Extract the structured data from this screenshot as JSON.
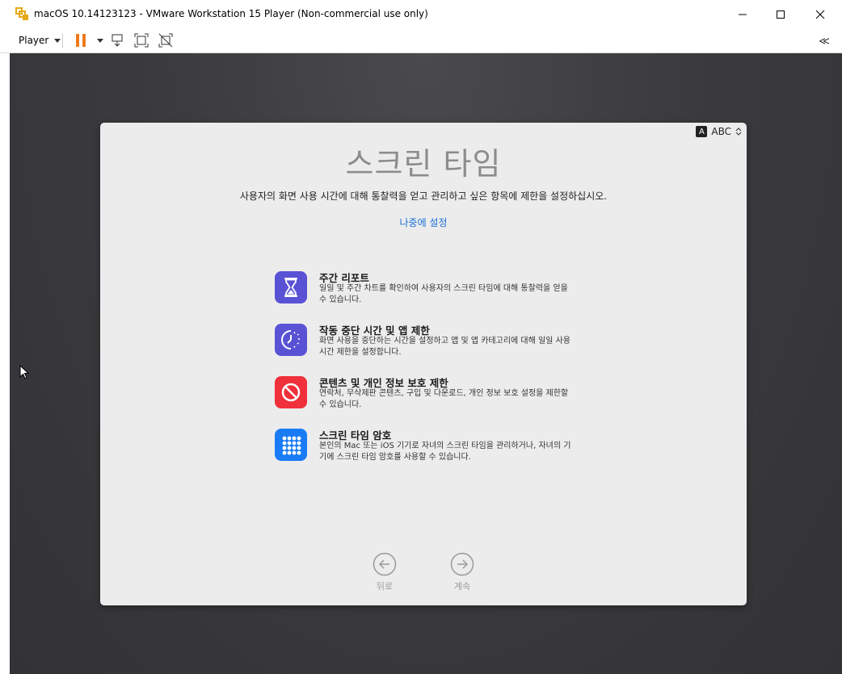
{
  "window": {
    "title": "macOS 10.14123123 - VMware Workstation 15 Player (Non-commercial use only)",
    "controls": [
      "minimize",
      "maximize",
      "close"
    ]
  },
  "toolbar": {
    "player_menu": "Player",
    "collapse_label": "≪"
  },
  "setup": {
    "input_source": "ABC",
    "input_badge": "A",
    "title": "스크린 타임",
    "description": "사용자의 화면 사용 시간에 대해 통찰력을 얻고 관리하고 싶은 항목에 제한을 설정하십시오.",
    "later_link": "나중에 설정",
    "features": [
      {
        "title": "주간 리포트",
        "desc": "일일 및 주간 차트를 확인하여 사용자의 스크린 타임에 대해 통찰력을 얻을 수 있습니다.",
        "icon": "hourglass-icon",
        "color": "#5a52d5"
      },
      {
        "title": "작동 중단 시간 및 앱 제한",
        "desc": "화면 사용을 중단하는 시간을 설정하고 앱 및 앱 카테고리에 대해 일일 사용 시간 제한을 설정합니다.",
        "icon": "downtime-icon",
        "color": "#5a52d5"
      },
      {
        "title": "콘텐츠 및 개인 정보 보호 제한",
        "desc": "연락처, 무삭제판 콘텐츠, 구입 및 다운로드, 개인 정보 보호 설정을 제한할 수 있습니다.",
        "icon": "restriction-icon",
        "color": "#f0303a"
      },
      {
        "title": "스크린 타임 암호",
        "desc": "본인의 Mac 또는 iOS 기기로 자녀의 스크린 타임을 관리하거나, 자녀의 기기에 스크린 타임 암호를 사용할 수 있습니다.",
        "icon": "keypad-icon",
        "color": "#1a7cf5"
      }
    ],
    "back_label": "뒤로",
    "continue_label": "계속"
  }
}
